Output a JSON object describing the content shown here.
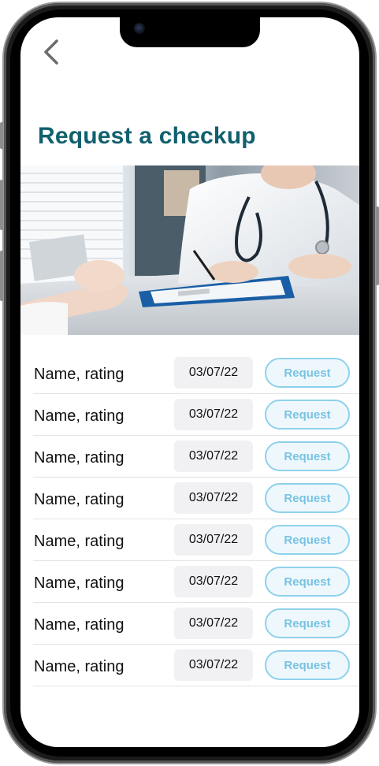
{
  "header": {
    "back_icon": "chevron-left-icon",
    "title": "Request a checkup"
  },
  "hero_image": {
    "subject": "doctor-consultation-photo"
  },
  "rows": [
    {
      "name": "Name, rating",
      "date": "03/07/22",
      "action": "Request"
    },
    {
      "name": "Name, rating",
      "date": "03/07/22",
      "action": "Request"
    },
    {
      "name": "Name, rating",
      "date": "03/07/22",
      "action": "Request"
    },
    {
      "name": "Name, rating",
      "date": "03/07/22",
      "action": "Request"
    },
    {
      "name": "Name, rating",
      "date": "03/07/22",
      "action": "Request"
    },
    {
      "name": "Name, rating",
      "date": "03/07/22",
      "action": "Request"
    },
    {
      "name": "Name, rating",
      "date": "03/07/22",
      "action": "Request"
    },
    {
      "name": "Name, rating",
      "date": "03/07/22",
      "action": "Request"
    }
  ],
  "colors": {
    "title": "#11606e",
    "request_border": "#8fd1ec",
    "request_text": "#78c3e3",
    "date_bg": "#f1f1f4"
  }
}
